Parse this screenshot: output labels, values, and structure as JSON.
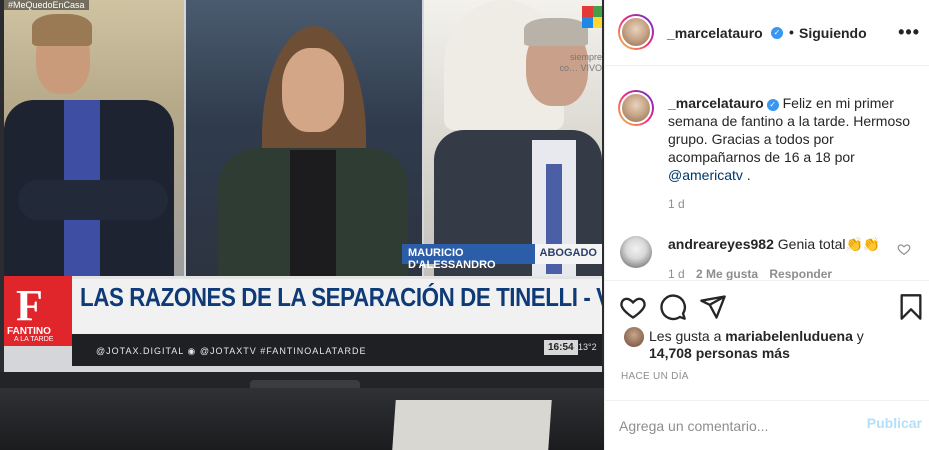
{
  "photo": {
    "tv_hashtag": "#MeQuedoEnCasa",
    "channel_overlay": "siempre co… VIVO",
    "name_tag": {
      "name": "MAURICIO D'ALESSANDRO",
      "role": "ABOGADO"
    },
    "show_logo_letter": "F",
    "show_logo_name": "FANTINO",
    "show_logo_sub": "A LA TARDE",
    "headline": "LAS RAZONES DE LA SEPARACIÓN DE TINELLI - VALDÉS",
    "ticker_social": "@JOTAX.DIGITAL   ◉ @JOTAXTV   #FANTINOALATARDE",
    "ticker_time": "16:54",
    "ticker_temp": "13°2"
  },
  "header": {
    "username": "_marcelatauro",
    "follow_label": "Siguiendo",
    "more_label": "•••"
  },
  "caption": {
    "username": "_marcelatauro",
    "text": "Feliz en mi primer semana de fantino a la tarde. Hermoso grupo. Gracias a todos por acompañarnos de 16 a 18 por ",
    "mention": "@americatv",
    "text_end": " .",
    "age": "1 d"
  },
  "reply": {
    "username": "andreareyes982",
    "text": "Genia total👏👏",
    "age": "1 d",
    "likes": "2 Me gusta",
    "reply_label": "Responder"
  },
  "likes": {
    "prefix": "Les gusta a",
    "user": "mariabelenluduena",
    "connector": "y",
    "others": "14,708 personas más"
  },
  "timeago": "HACE UN DÍA",
  "comment_box": {
    "placeholder": "Agrega un comentario...",
    "publish_label": "Publicar"
  },
  "colors": {
    "accent_link": "#00376b",
    "verified": "#3897f0",
    "publish_disabled": "#b2dffc",
    "banner_red": "#e0262b",
    "banner_blue": "#0f3a78"
  }
}
